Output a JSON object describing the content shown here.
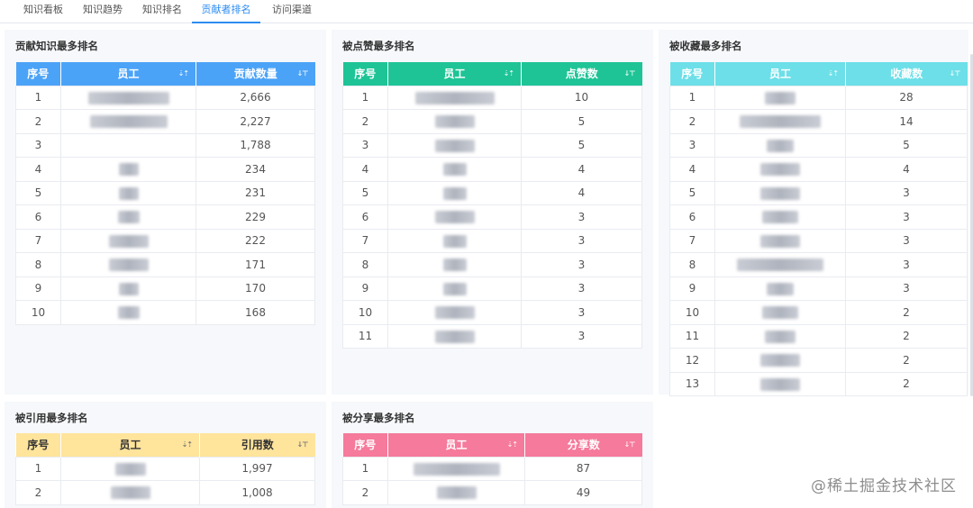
{
  "tabs": [
    "知识看板",
    "知识趋势",
    "知识排名",
    "贡献者排名",
    "访问渠道"
  ],
  "active_tab": "贡献者排名",
  "colors": {
    "blue": "#4ba3f7",
    "green": "#1ec496",
    "cyan": "#6ddfe8",
    "yellow": "#ffe49c",
    "pink": "#f57a9b"
  },
  "panels": {
    "contrib": {
      "title": "贡献知识最多排名",
      "headers": [
        "序号",
        "员工",
        "贡献数量"
      ],
      "rows": [
        [
          "1",
          "2,666"
        ],
        [
          "2",
          "2,227"
        ],
        [
          "3",
          "1,788"
        ],
        [
          "4",
          "234"
        ],
        [
          "5",
          "231"
        ],
        [
          "6",
          "229"
        ],
        [
          "7",
          "222"
        ],
        [
          "8",
          "171"
        ],
        [
          "9",
          "170"
        ],
        [
          "10",
          "168"
        ]
      ]
    },
    "likes": {
      "title": "被点赞最多排名",
      "headers": [
        "序号",
        "员工",
        "点赞数"
      ],
      "rows": [
        [
          "1",
          "10"
        ],
        [
          "2",
          "5"
        ],
        [
          "3",
          "5"
        ],
        [
          "4",
          "4"
        ],
        [
          "5",
          "4"
        ],
        [
          "6",
          "3"
        ],
        [
          "7",
          "3"
        ],
        [
          "8",
          "3"
        ],
        [
          "9",
          "3"
        ],
        [
          "10",
          "3"
        ],
        [
          "11",
          "3"
        ]
      ]
    },
    "favorites": {
      "title": "被收藏最多排名",
      "headers": [
        "序号",
        "员工",
        "收藏数"
      ],
      "rows": [
        [
          "1",
          "28"
        ],
        [
          "2",
          "14"
        ],
        [
          "3",
          "5"
        ],
        [
          "4",
          "4"
        ],
        [
          "5",
          "3"
        ],
        [
          "6",
          "3"
        ],
        [
          "7",
          "3"
        ],
        [
          "8",
          "3"
        ],
        [
          "9",
          "3"
        ],
        [
          "10",
          "2"
        ],
        [
          "11",
          "2"
        ],
        [
          "12",
          "2"
        ],
        [
          "13",
          "2"
        ]
      ]
    },
    "cited": {
      "title": "被引用最多排名",
      "headers": [
        "序号",
        "员工",
        "引用数"
      ],
      "rows": [
        [
          "1",
          "1,997"
        ],
        [
          "2",
          "1,008"
        ]
      ]
    },
    "shared": {
      "title": "被分享最多排名",
      "headers": [
        "序号",
        "员工",
        "分享数"
      ],
      "rows": [
        [
          "1",
          "87"
        ],
        [
          "2",
          "49"
        ]
      ]
    }
  },
  "watermark": "@稀土掘金技术社区"
}
